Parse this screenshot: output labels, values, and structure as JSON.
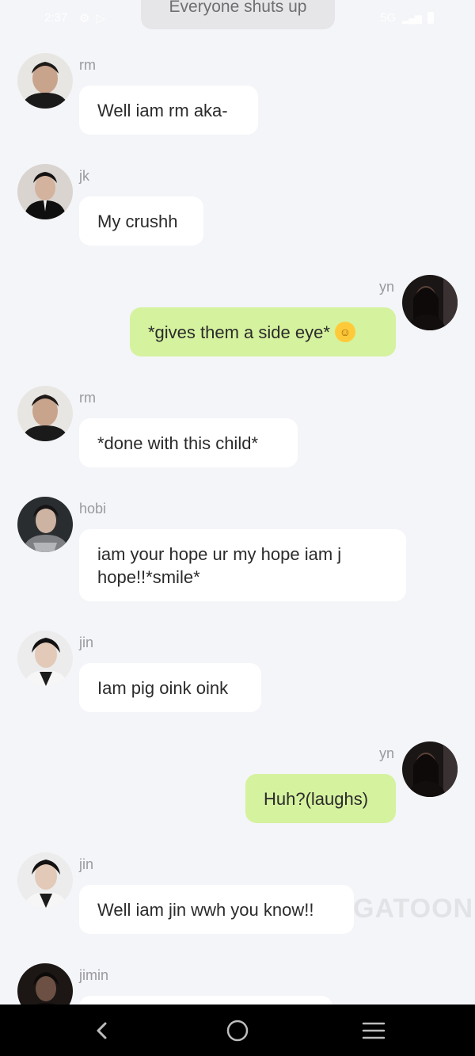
{
  "status_bar": {
    "time": "2:37",
    "signal": "5G"
  },
  "narration": "Everyone shuts up",
  "messages": [
    {
      "sender": "rm",
      "text": "Well iam rm aka-"
    },
    {
      "sender": "jk",
      "text": "My crushh"
    },
    {
      "sender": "yn",
      "text": "*gives them a side eye*"
    },
    {
      "sender": "rm",
      "text": "*done with this child*"
    },
    {
      "sender": "hobi",
      "text": "iam your hope ur my hope iam j hope!!*smile*"
    },
    {
      "sender": "jin",
      "text": "Iam pig oink oink"
    },
    {
      "sender": "yn",
      "text": "Huh?(laughs)"
    },
    {
      "sender": "jin",
      "text": "Well iam jin wwh you know!!"
    },
    {
      "sender": "jimin",
      "text": ""
    }
  ],
  "watermark": "GATOON",
  "nav": {
    "back_icon": "chevron-left-icon",
    "home_icon": "circle-home-icon",
    "recent_icon": "menu-lines-icon"
  },
  "colors": {
    "background": "#f4f5f8",
    "bubble_other": "#ffffff",
    "bubble_self": "#d5f29e",
    "name_text": "#9a9a9e"
  }
}
